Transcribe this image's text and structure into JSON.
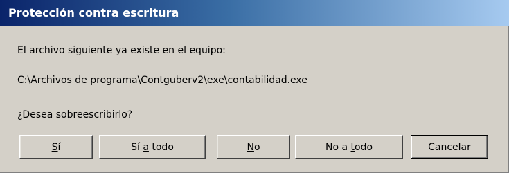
{
  "window": {
    "title": "Protección contra escritura"
  },
  "message": {
    "line1": "El archivo siguiente ya existe en el equipo:",
    "path": "C:\\Archivos de programa\\Contguberv2\\exe\\contabilidad.exe",
    "question": "¿Desea sobreescribirlo?"
  },
  "buttons": {
    "yes": {
      "pre": "",
      "mnemonic": "S",
      "post": "í"
    },
    "yes_all": {
      "pre": "Sí ",
      "mnemonic": "a",
      "post": " todo"
    },
    "no": {
      "pre": "",
      "mnemonic": "N",
      "post": "o"
    },
    "no_all": {
      "pre": "No a ",
      "mnemonic": "t",
      "post": "odo"
    },
    "cancel": {
      "label": "Cancelar"
    }
  },
  "colors": {
    "dialog_bg": "#d4d0c8",
    "title_start": "#0a246a",
    "title_end": "#a6caf0"
  }
}
